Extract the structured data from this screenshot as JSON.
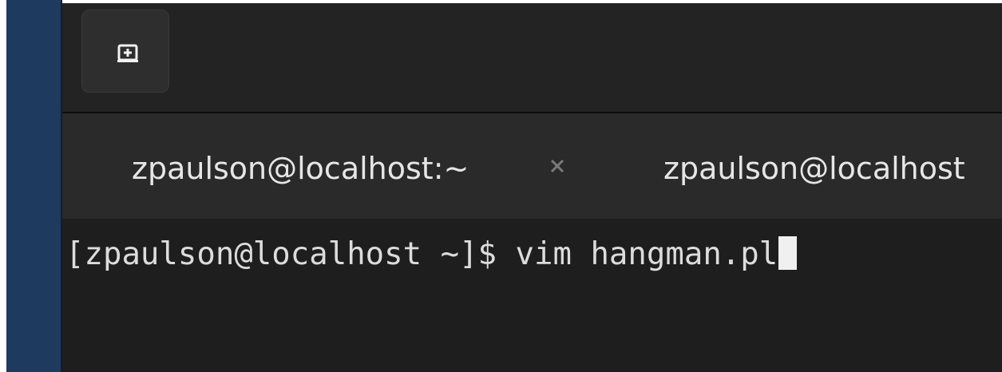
{
  "headerbar": {
    "new_tab_icon": "new-tab-icon"
  },
  "tabs": [
    {
      "title": "zpaulson@localhost:~",
      "close_icon": "close-icon"
    },
    {
      "title": "zpaulson@localhost"
    }
  ],
  "terminal": {
    "prompt": "[zpaulson@localhost ~]$ ",
    "command": "vim hangman.pl"
  },
  "colors": {
    "desktop_edge": "#1f3a5f",
    "headerbar_bg": "#232323",
    "tabbar_bg": "#2a2a2a",
    "terminal_bg": "#1e1e1e",
    "text": "#e6e6e6"
  }
}
